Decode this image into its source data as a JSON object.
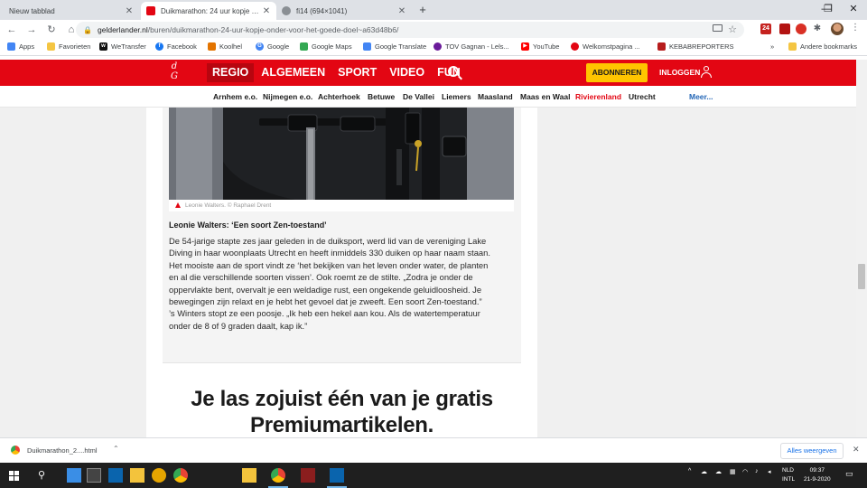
{
  "browser": {
    "tabs": [
      {
        "label": "Nieuw tabblad",
        "active": false
      },
      {
        "label": "Duikmarathon: 24 uur kopje onder",
        "active": true
      },
      {
        "label": "fi14 (694×1041)",
        "active": false
      }
    ],
    "url_host": "gelderlander.nl",
    "url_path": "/buren/duikmarathon-24-uur-kopje-onder-voor-het-goede-doel~a63d48b6/",
    "bookmarks": [
      "Apps",
      "Favorieten",
      "WeTransfer",
      "Facebook",
      "Koolhel",
      "Google",
      "Google Maps",
      "Google Translate",
      "TOV Gagnan - Lels...",
      "YouTube",
      "Welkomstpagina ...",
      "KEBABREPORTERS",
      "Andere bookmarks"
    ],
    "bookmarks_more": "»",
    "ext_badge": "24"
  },
  "site": {
    "logo_top": "d",
    "logo_bottom": "G",
    "nav": [
      "REGIO",
      "ALGEMEEN",
      "SPORT",
      "VIDEO",
      "FUN"
    ],
    "subscribe_label": "ABONNEREN",
    "login_label": "INLOGGEN",
    "regions": [
      "Arnhem e.o.",
      "Nijmegen e.o.",
      "Achterhoek",
      "Betuwe",
      "De Vallei",
      "Liemers",
      "Maasland",
      "Maas en Waal",
      "Rivierenland",
      "Utrecht"
    ],
    "regions_more": "Meer..."
  },
  "article": {
    "photo_caption": "Leonie Walters. © Raphael Drent",
    "subheading": "Leonie Walters: ‘Een soort Zen-toestand’",
    "body_lines": [
      "De 54-jarige stapte zes jaar geleden in de duiksport, werd lid van de vereniging Lake",
      "Diving in haar woonplaats Utrecht en heeft inmiddels 330 duiken op haar naam staan.",
      "Het mooiste aan de sport vindt ze ‘het bekijken van het leven onder water, de planten",
      "en al die verschillende soorten vissen’. Ook roemt ze de stilte. „Zodra je onder de",
      "oppervlakte bent, overvalt je een weldadige rust, een ongekende geluidloosheid. Je",
      "bewegingen zijn relaxt en je hebt het gevoel dat je zweeft. Een soort Zen-toestand.”",
      "’s Winters stopt ze een poosje. „Ik heb een hekel aan kou. Als de watertemperatuur",
      "onder de 8 of 9 graden daalt, kap ik.”"
    ],
    "premium_line1": "Je las zojuist één van je gratis",
    "premium_line2": "Premiumartikelen."
  },
  "downloads": {
    "file_label": "Duikmarathon_2....html",
    "show_all_label": "Alles weergeven"
  },
  "taskbar": {
    "lang_line1": "NLD",
    "lang_line2": "INTL",
    "time": "09:37",
    "date": "21-9-2020"
  },
  "colors": {
    "brand_red": "#e30613",
    "subscribe_yellow": "#ffc500",
    "region_active_red": "#e30613",
    "more_blue": "#2366b6"
  }
}
